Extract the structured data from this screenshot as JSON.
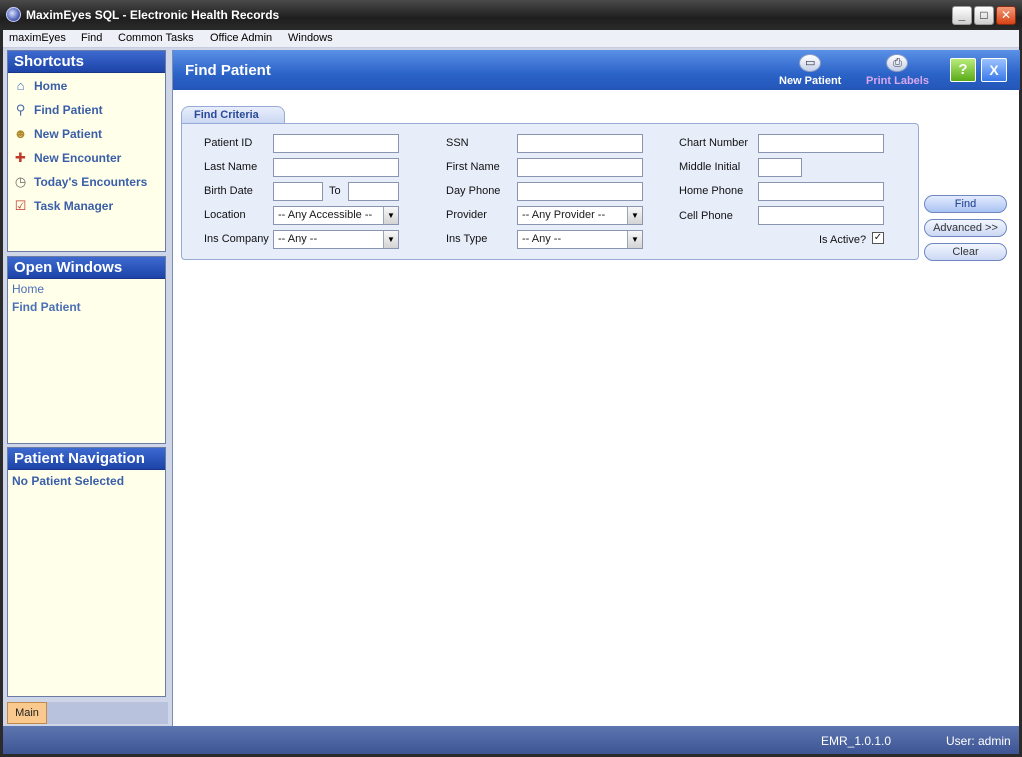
{
  "window": {
    "title": "MaximEyes SQL - Electronic Health Records"
  },
  "menu": [
    "maximEyes",
    "Find",
    "Common Tasks",
    "Office Admin",
    "Windows"
  ],
  "shortcuts": {
    "title": "Shortcuts",
    "items": [
      {
        "label": "Home",
        "icon": "home-icon"
      },
      {
        "label": "Find Patient",
        "icon": "magnifier-icon"
      },
      {
        "label": "New Patient",
        "icon": "people-icon"
      },
      {
        "label": "New Encounter",
        "icon": "encounter-icon"
      },
      {
        "label": "Today's Encounters",
        "icon": "clock-icon"
      },
      {
        "label": "Task Manager",
        "icon": "checklist-icon"
      }
    ]
  },
  "open_windows": {
    "title": "Open Windows",
    "items": [
      "Home",
      "Find Patient"
    ]
  },
  "patient_nav": {
    "title": "Patient Navigation",
    "text": "No Patient Selected"
  },
  "bottom_tab": "Main",
  "main": {
    "title": "Find Patient",
    "new_patient": "New Patient",
    "print_labels": "Print Labels",
    "help": "?",
    "close": "X"
  },
  "criteria": {
    "tab": "Find Criteria",
    "patient_id": "Patient ID",
    "last_name": "Last Name",
    "birth_date": "Birth Date",
    "to": "To",
    "location": "Location",
    "location_value": "-- Any Accessible --",
    "ins_company": "Ins Company",
    "ins_company_value": "-- Any --",
    "ssn": "SSN",
    "first_name": "First Name",
    "day_phone": "Day Phone",
    "provider": "Provider",
    "provider_value": "-- Any Provider --",
    "ins_type": "Ins Type",
    "ins_type_value": "-- Any --",
    "chart_number": "Chart Number",
    "middle_initial": "Middle Initial",
    "home_phone": "Home Phone",
    "cell_phone": "Cell Phone",
    "is_active": "Is Active?",
    "is_active_checked": "✓"
  },
  "buttons": {
    "find": "Find",
    "advanced": "Advanced >>",
    "clear": "Clear"
  },
  "status": {
    "version": "EMR_1.0.1.0",
    "user": "User: admin"
  }
}
